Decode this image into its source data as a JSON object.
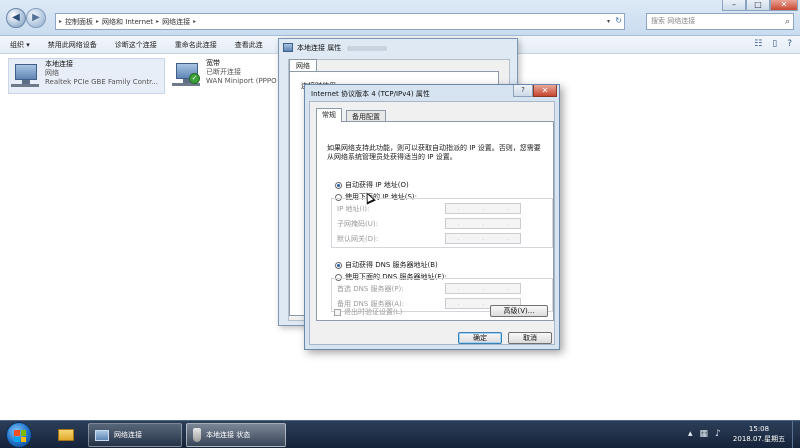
{
  "explorer": {
    "address": [
      "控制面板",
      "网络和 Internet",
      "网络连接"
    ],
    "search_placeholder": "搜索 网络连接",
    "toolbar": [
      "组织 ▾",
      "禁用此网络设备",
      "诊断这个连接",
      "重命名此连接",
      "查看此连"
    ],
    "connections": [
      {
        "name": "本地连接",
        "line2": "网络",
        "line3": "Realtek PCIe GBE Family Contr..."
      },
      {
        "name": "宽带",
        "line2": "已断开连接",
        "line3": "WAN Miniport (PPPO"
      }
    ]
  },
  "back_dialog": {
    "title": "本地连接 属性",
    "tab": "网络",
    "connect_using": "连接时使用:"
  },
  "dialog": {
    "title": "Internet 协议版本 4 (TCP/IPv4) 属性",
    "help": "?",
    "close": "✕",
    "tabs": [
      "常规",
      "备用配置"
    ],
    "description": "如果网络支持此功能，则可以获取自动指派的 IP 设置。否则，您需要从网络系统管理员处获得适当的 IP 设置。",
    "ip_auto": "自动获得 IP 地址(O)",
    "ip_manual": "使用下面的 IP 地址(S):",
    "ip_fields": [
      "IP 地址(I):",
      "子网掩码(U):",
      "默认网关(D):"
    ],
    "dns_auto": "自动获得 DNS 服务器地址(B)",
    "dns_manual": "使用下面的 DNS 服务器地址(E):",
    "dns_fields": [
      "首选 DNS 服务器(P):",
      "备用 DNS 服务器(A):"
    ],
    "validate": "退出时验证设置(L)",
    "advanced": "高级(V)...",
    "ok": "确定",
    "cancel": "取消"
  },
  "taskbar": {
    "app1": "网络连接",
    "app2": "本地连接 状态",
    "time": "15:08",
    "date": "2018.07.星期五"
  }
}
